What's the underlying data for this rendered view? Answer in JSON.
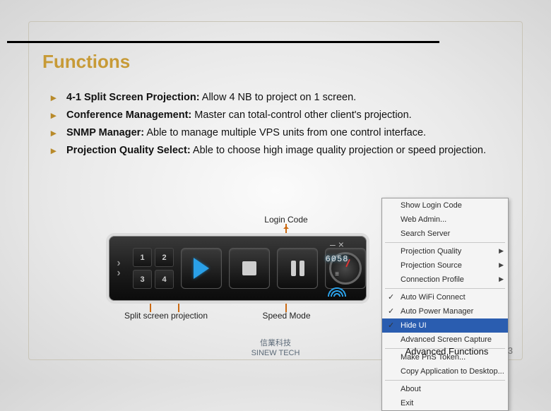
{
  "title": "Functions",
  "bullets": [
    {
      "bold": "4-1 Split Screen Projection:",
      "rest": " Allow 4 NB to project on 1 screen."
    },
    {
      "bold": "Conference Management:",
      "rest": " Master can total-control other client's projection."
    },
    {
      "bold": "SNMP Manager:",
      "rest": " Able to manage multiple VPS units from one control interface."
    },
    {
      "bold": "Projection Quality Select:",
      "rest": " Able to choose high image quality projection or speed projection."
    }
  ],
  "labels": {
    "login": "Login Code",
    "split": "Split screen projection",
    "speed": "Speed Mode",
    "advanced": "Advanced Functions"
  },
  "player": {
    "quad": [
      "1",
      "2",
      "3",
      "4"
    ],
    "login_code": "6058"
  },
  "menu": {
    "items": [
      {
        "label": "Show Login Code"
      },
      {
        "label": "Web Admin..."
      },
      {
        "label": "Search Server"
      }
    ],
    "items2": [
      {
        "label": "Projection Quality",
        "sub": true
      },
      {
        "label": "Projection Source",
        "sub": true
      },
      {
        "label": "Connection Profile",
        "sub": true
      }
    ],
    "items3": [
      {
        "label": "Auto WiFi Connect",
        "chk": true
      },
      {
        "label": "Auto Power Manager",
        "chk": true
      },
      {
        "label": "Hide UI",
        "chk": true,
        "hl": true
      },
      {
        "label": "Advanced Screen Capture"
      }
    ],
    "items4": [
      {
        "label": "Make PnS Token..."
      },
      {
        "label": "Copy Application to Desktop..."
      }
    ],
    "items5": [
      {
        "label": "About"
      },
      {
        "label": "Exit"
      }
    ]
  },
  "footer": {
    "cn": "信業科技",
    "en": "SINEW TECH"
  },
  "page_number": "3"
}
